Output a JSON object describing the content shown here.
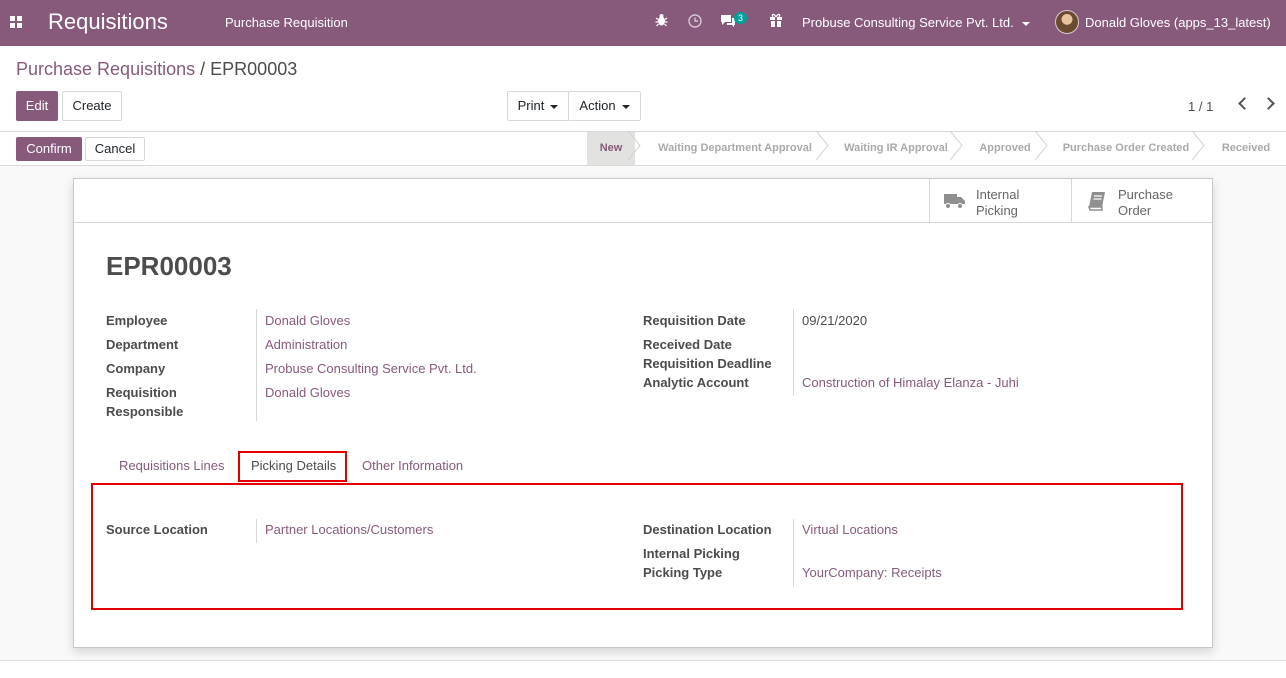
{
  "navbar": {
    "app_title": "Requisitions",
    "menu_item": "Purchase Requisition",
    "chat_badge": "3",
    "company": "Probuse Consulting Service Pvt. Ltd.",
    "user": "Donald Gloves (apps_13_latest)"
  },
  "breadcrumb": {
    "parent": "Purchase Requisitions",
    "separator": "/",
    "current": "EPR00003"
  },
  "controls": {
    "edit": "Edit",
    "create": "Create",
    "print": "Print",
    "action": "Action",
    "pager": "1 / 1"
  },
  "statusbar": {
    "confirm": "Confirm",
    "cancel": "Cancel",
    "stages": [
      "New",
      "Waiting Department Approval",
      "Waiting IR Approval",
      "Approved",
      "Purchase Order Created",
      "Received"
    ],
    "active_stage": "New"
  },
  "smart_buttons": [
    {
      "line1": "Internal",
      "line2": "Picking",
      "icon": "truck-icon"
    },
    {
      "line1": "Purchase",
      "line2": "Order",
      "icon": "book-icon"
    }
  ],
  "record": {
    "name": "EPR00003",
    "left": [
      {
        "label": "Employee",
        "value": "Donald Gloves"
      },
      {
        "label": "Department",
        "value": "Administration"
      },
      {
        "label": "Company",
        "value": "Probuse Consulting Service Pvt. Ltd."
      },
      {
        "label": "Requisition",
        "label2": "Responsible",
        "value": "Donald Gloves"
      }
    ],
    "right": [
      {
        "label": "Requisition Date",
        "value": "09/21/2020"
      },
      {
        "label": "Received Date",
        "value": ""
      },
      {
        "label": "Requisition Deadline",
        "value": ""
      },
      {
        "label": "Analytic Account",
        "value": "Construction of Himalay Elanza - Juhi"
      }
    ]
  },
  "tabs": [
    "Requisitions Lines",
    "Picking Details",
    "Other Information"
  ],
  "active_tab": "Picking Details",
  "picking": {
    "source_label": "Source Location",
    "source_value": "Partner Locations/Customers",
    "dest_label": "Destination Location",
    "dest_value": "Virtual Locations",
    "internal_label": "Internal Picking",
    "type_label": "Picking Type",
    "type_value": "YourCompany: Receipts"
  },
  "colors": {
    "brand": "#875a7b",
    "highlight": "#e20000",
    "badge": "#00a09d"
  }
}
